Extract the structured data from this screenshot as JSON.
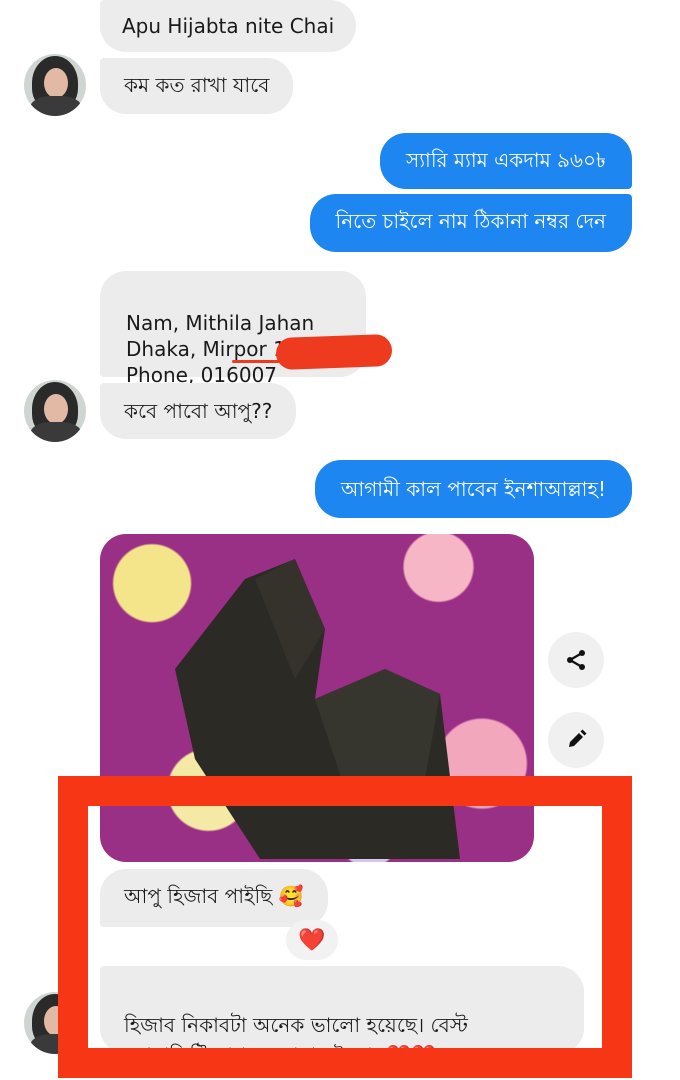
{
  "messages": {
    "m1": "Apu Hijabta nite Chai",
    "m2": "কম কত রাখা যাবে",
    "m3": "স্যারি ম্যাম একদাম ৯৬০৳",
    "m4": "নিতে চাইলে নাম ঠিকানা নম্বর দেন",
    "m5": "Nam, Mithila Jahan\nDhaka, Mirpor 10\nPhone, 016007",
    "m6": "কবে পাবো আপু??",
    "m7": "আগামী কাল পাবেন ইনশাআল্লাহ!",
    "m8": "আপু হিজাব পাইছি 🥰",
    "m9_reaction": "❤️",
    "m10": "হিজাব নিকাবটা অনেক ভালো হয়েছে। বেস্ট\nকোয়ালিটি কাপড়। দোয়া রইলো। ❤️❤️"
  },
  "icons": {
    "share": "share-icon",
    "edit": "pencil-icon",
    "avatar": "contact-avatar"
  },
  "colors": {
    "outgoing_bubble": "#1e86f0",
    "incoming_bubble": "#ececec",
    "highlight_box": "#f63614",
    "redaction": "#ee3a1f"
  }
}
